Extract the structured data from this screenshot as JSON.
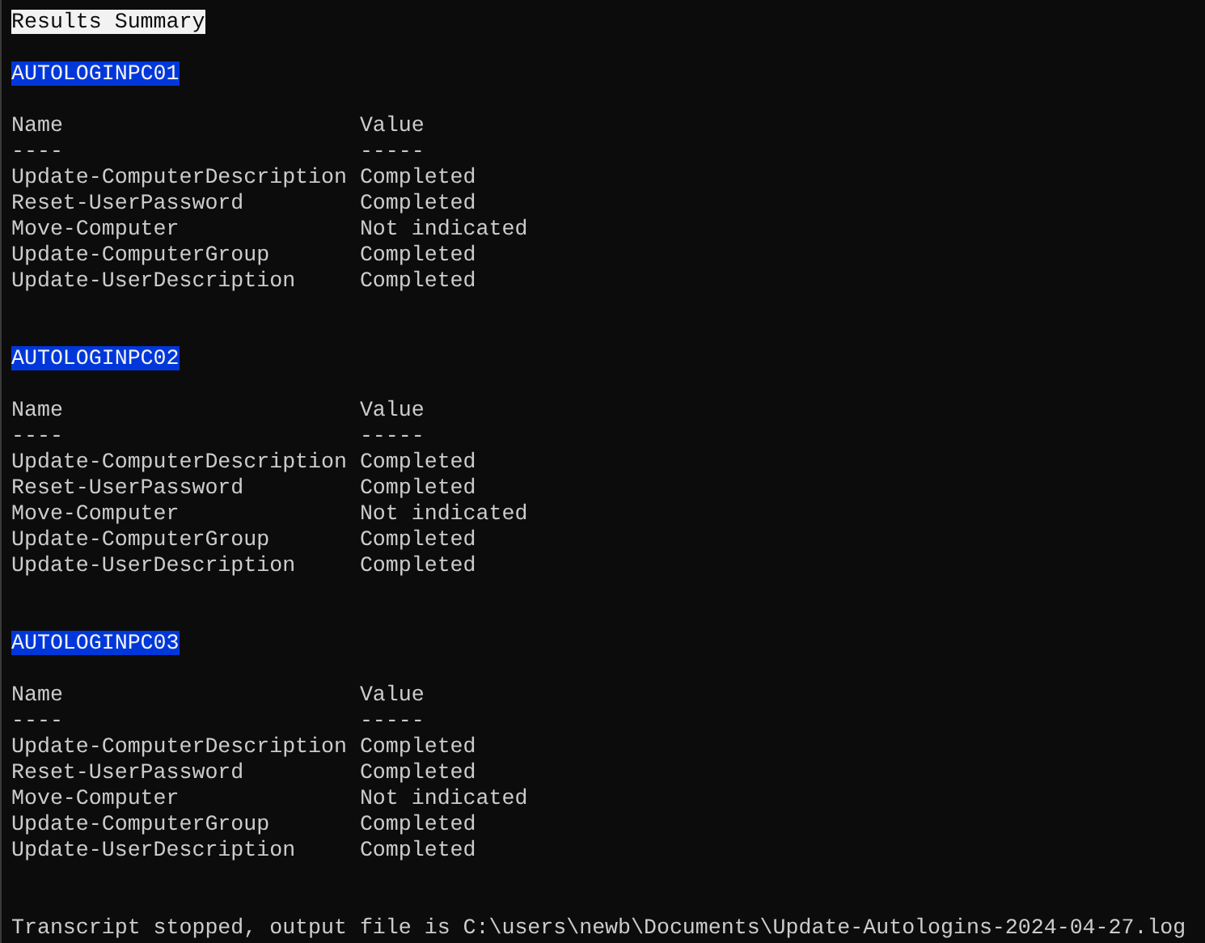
{
  "title": "Results Summary",
  "sections": [
    {
      "host": "AUTOLOGINPC01",
      "columns": [
        "Name",
        "Value"
      ],
      "underlines": [
        "----",
        "-----"
      ],
      "rows": [
        {
          "name": "Update-ComputerDescription",
          "value": "Completed"
        },
        {
          "name": "Reset-UserPassword",
          "value": "Completed"
        },
        {
          "name": "Move-Computer",
          "value": "Not indicated"
        },
        {
          "name": "Update-ComputerGroup",
          "value": "Completed"
        },
        {
          "name": "Update-UserDescription",
          "value": "Completed"
        }
      ]
    },
    {
      "host": "AUTOLOGINPC02",
      "columns": [
        "Name",
        "Value"
      ],
      "underlines": [
        "----",
        "-----"
      ],
      "rows": [
        {
          "name": "Update-ComputerDescription",
          "value": "Completed"
        },
        {
          "name": "Reset-UserPassword",
          "value": "Completed"
        },
        {
          "name": "Move-Computer",
          "value": "Not indicated"
        },
        {
          "name": "Update-ComputerGroup",
          "value": "Completed"
        },
        {
          "name": "Update-UserDescription",
          "value": "Completed"
        }
      ]
    },
    {
      "host": "AUTOLOGINPC03",
      "columns": [
        "Name",
        "Value"
      ],
      "underlines": [
        "----",
        "-----"
      ],
      "rows": [
        {
          "name": "Update-ComputerDescription",
          "value": "Completed"
        },
        {
          "name": "Reset-UserPassword",
          "value": "Completed"
        },
        {
          "name": "Move-Computer",
          "value": "Not indicated"
        },
        {
          "name": "Update-ComputerGroup",
          "value": "Completed"
        },
        {
          "name": "Update-UserDescription",
          "value": "Completed"
        }
      ]
    }
  ],
  "footer": "Transcript stopped, output file is C:\\users\\newb\\Documents\\Update-Autologins-2024-04-27.log"
}
